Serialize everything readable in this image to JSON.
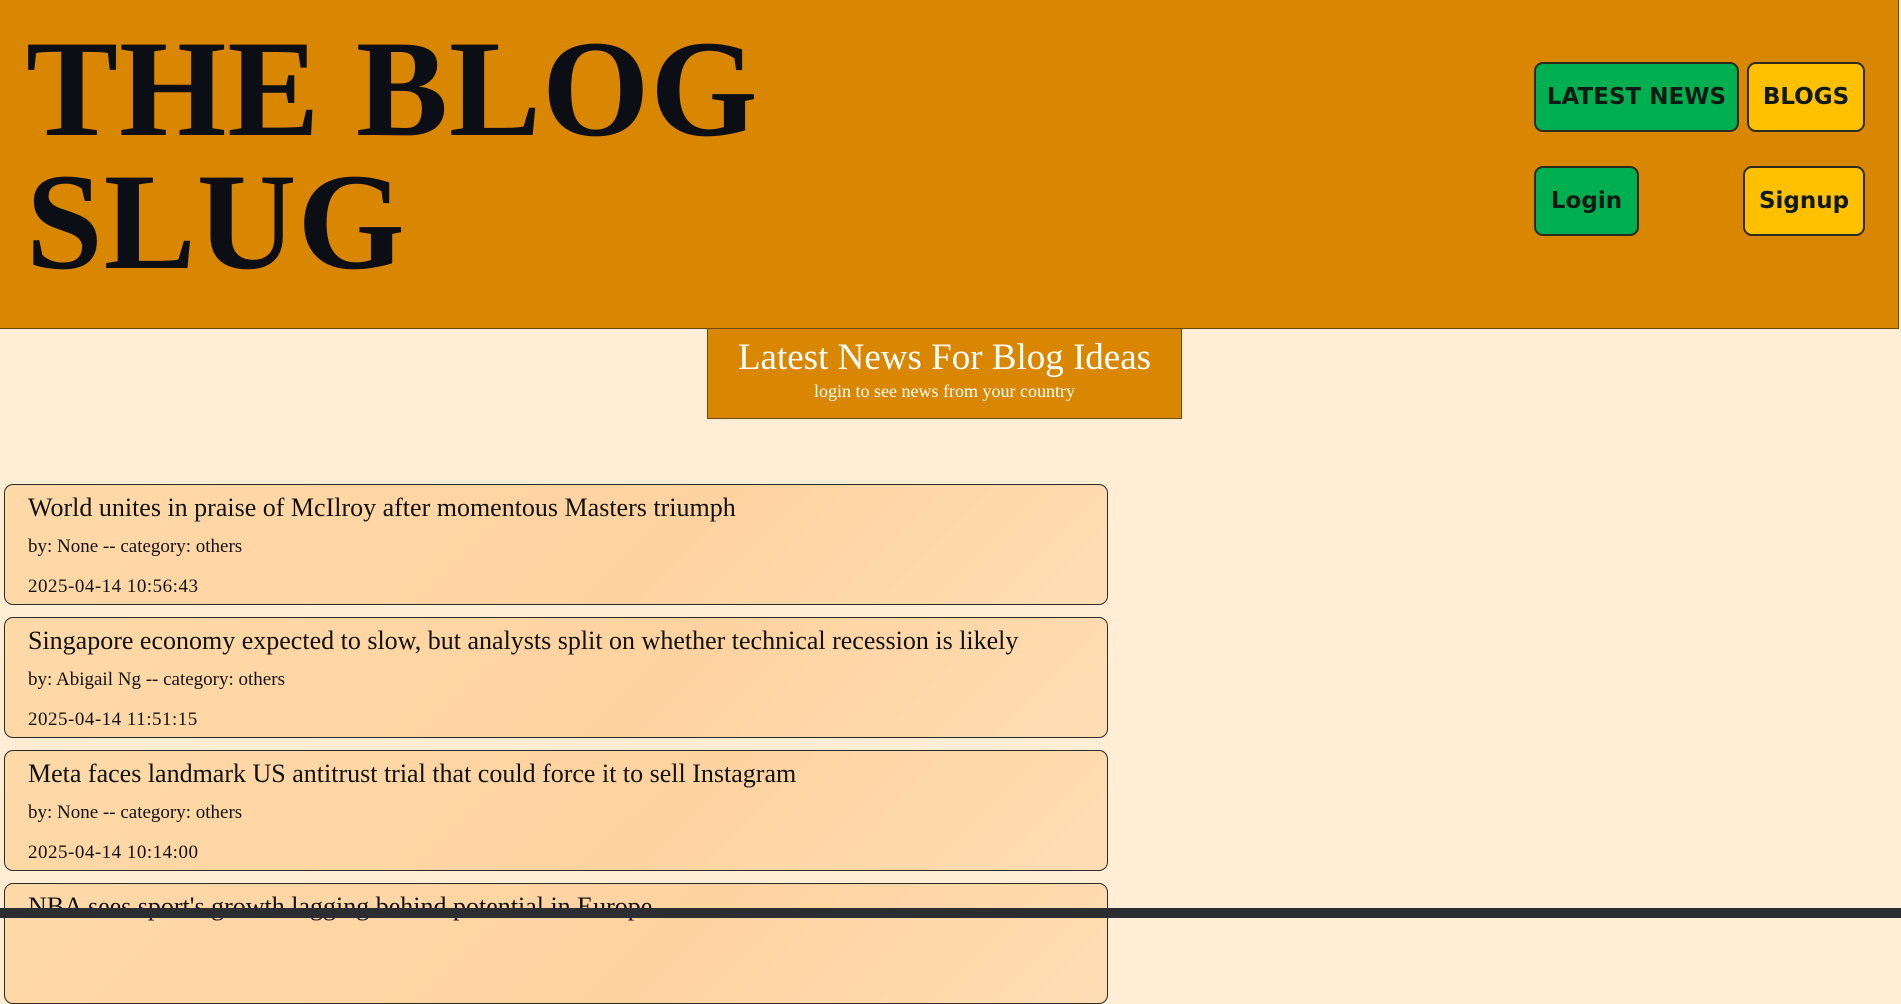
{
  "header": {
    "site_title_line1": "THE BLOG",
    "site_title_line2": "SLUG",
    "nav": {
      "latest_news": "LATEST NEWS",
      "blogs": "BLOGS",
      "login": "Login",
      "signup": "Signup"
    }
  },
  "banner": {
    "title": "Latest News For Blog Ideas",
    "subtitle": "login to see news from your country"
  },
  "news": [
    {
      "title": "World unites in praise of McIlroy after momentous Masters triumph",
      "meta": "by: None -- category: others",
      "date": "2025-04-14 10:56:43"
    },
    {
      "title": "Singapore economy expected to slow, but analysts split on whether technical recession is likely",
      "meta": "by: Abigail Ng -- category: others",
      "date": "2025-04-14 11:51:15"
    },
    {
      "title": "Meta faces landmark US antitrust trial that could force it to sell Instagram",
      "meta": "by: None -- category: others",
      "date": "2025-04-14 10:14:00"
    },
    {
      "title": "NBA sees sport's growth lagging behind potential in Europe",
      "meta": "",
      "date": ""
    }
  ],
  "colors": {
    "header_bg": "#D98600",
    "page_bg": "#FFEDD5",
    "card_bg": "#FFD9A8",
    "button_green": "#00B050",
    "button_yellow": "#FFC000"
  }
}
